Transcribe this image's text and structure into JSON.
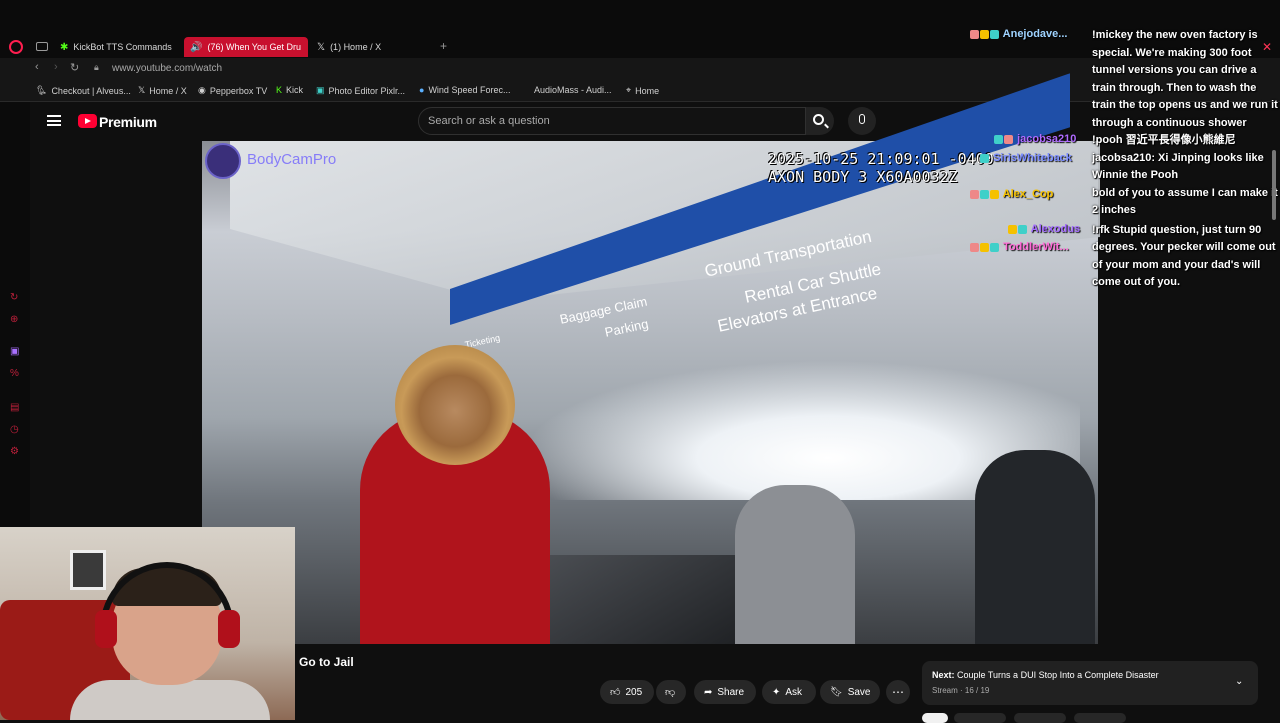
{
  "browser": {
    "tabs": [
      {
        "label": "KickBot TTS Commands",
        "icon": "kickbot-icon"
      },
      {
        "label": "(76) When You Get Dru",
        "icon": "speaker-icon",
        "active": true
      },
      {
        "label": "(1) Home / X",
        "icon": "x-icon"
      }
    ],
    "new_tab": "+",
    "url": "www.youtube.com/watch",
    "bookmarks": [
      {
        "label": "Checkout | Alveus...",
        "icon": "alveus-icon"
      },
      {
        "label": "Home / X",
        "icon": "x-icon"
      },
      {
        "label": "Pepperbox TV",
        "icon": "pepperbox-icon"
      },
      {
        "label": "Kick",
        "icon": "kick-icon"
      },
      {
        "label": "Photo Editor Pixlr...",
        "icon": "pixlr-icon"
      },
      {
        "label": "Wind Speed Forec...",
        "icon": "wind-icon"
      },
      {
        "label": "AudioMass - Audi...",
        "icon": "audiomass-icon"
      },
      {
        "label": "Home",
        "icon": "pin-icon"
      }
    ]
  },
  "youtube": {
    "brand": "Premium",
    "search_placeholder": "Search or ask a question",
    "video_title": "Go to Jail",
    "likes": "205",
    "actions": {
      "share": "Share",
      "ask": "Ask",
      "save": "Save"
    },
    "next": {
      "prefix": "Next:",
      "title": "Couple Turns a DUI Stop Into a Complete Disaster",
      "sub": "Stream · 16 / 19"
    }
  },
  "video": {
    "timestamp_line1": "2025-10-25 21:09:01 -0400",
    "timestamp_line2": "AXON BODY 3 X60A0032Z",
    "watermark": "BodyCamPro",
    "signs": {
      "line1": "Ground Transportation",
      "line2": "Rental Car Shuttle",
      "line3": "Elevators at Entrance",
      "left1": "Baggage Claim",
      "left2": "Parking",
      "ticketing": "Ticketing"
    }
  },
  "chat": {
    "names": [
      {
        "name": "Anejodave...",
        "color": "#9fd3ff"
      },
      {
        "name": "jacobsa210",
        "color": "#b06bff"
      },
      {
        "name": "SirisWhiteback",
        "color": "#7a8cff"
      },
      {
        "name": "Alex_Cop",
        "color": "#f5c100"
      },
      {
        "name": "Alexodus",
        "color": "#a46bff"
      },
      {
        "name": "ToddlerWit...",
        "color": "#ff6bd6"
      }
    ],
    "messages": [
      "!mickey the new oven factory is special. We're making 300 foot tunnel versions you can drive a train through. Then to wash the train the top opens us and we run it through a continuous shower",
      "!pooh 習近平長得像小熊維尼",
      "jacobsa210: Xi Jinping looks like Winnie the Pooh",
      "bold of you to assume I can make it 2 inches",
      "!rfk Stupid question, just turn 90 degrees. Your pecker will come out of your mom and your dad's will come out of you."
    ]
  }
}
